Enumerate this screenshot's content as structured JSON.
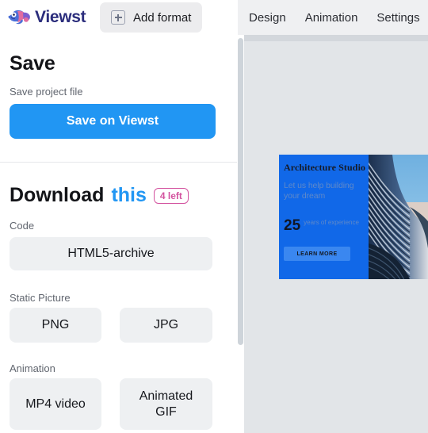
{
  "header": {
    "brand_name": "Viewst",
    "brand_icon": "chameleon-logo-icon",
    "brand_color": "#2b2d7c",
    "add_format_label": "Add format",
    "add_format_icon": "plus-square-icon",
    "nav_items": [
      {
        "label": "Design"
      },
      {
        "label": "Animation"
      },
      {
        "label": "Settings"
      }
    ]
  },
  "panel": {
    "save": {
      "title": "Save",
      "subtitle": "Save project file",
      "button_label": "Save on Viewst",
      "button_color": "#2196f3"
    },
    "download": {
      "title_part1": "Download",
      "title_part2": "this",
      "title_part2_color": "#2196f3",
      "badge_label": "4 left",
      "badge_color": "#d3539f",
      "groups": [
        {
          "label": "Code",
          "options": [
            {
              "label": "HTML5-archive"
            }
          ]
        },
        {
          "label": "Static Picture",
          "options": [
            {
              "label": "PNG"
            },
            {
              "label": "JPG"
            }
          ]
        },
        {
          "label": "Animation",
          "options": [
            {
              "label": "MP4 video"
            },
            {
              "label": "Animated GIF"
            }
          ]
        }
      ]
    }
  },
  "canvas": {
    "background_color": "#e2e5e8",
    "banner": {
      "background_color": "#1168e8",
      "title": "Architecture Studio",
      "subtitle": "Let us help building your dream",
      "stat_number": "25",
      "stat_caption": "years of experience",
      "cta_label": "LEARN MORE",
      "image_alt": "architecture-building-photo"
    }
  },
  "scrollbar": {
    "name": "panel-vertical-scrollbar"
  }
}
